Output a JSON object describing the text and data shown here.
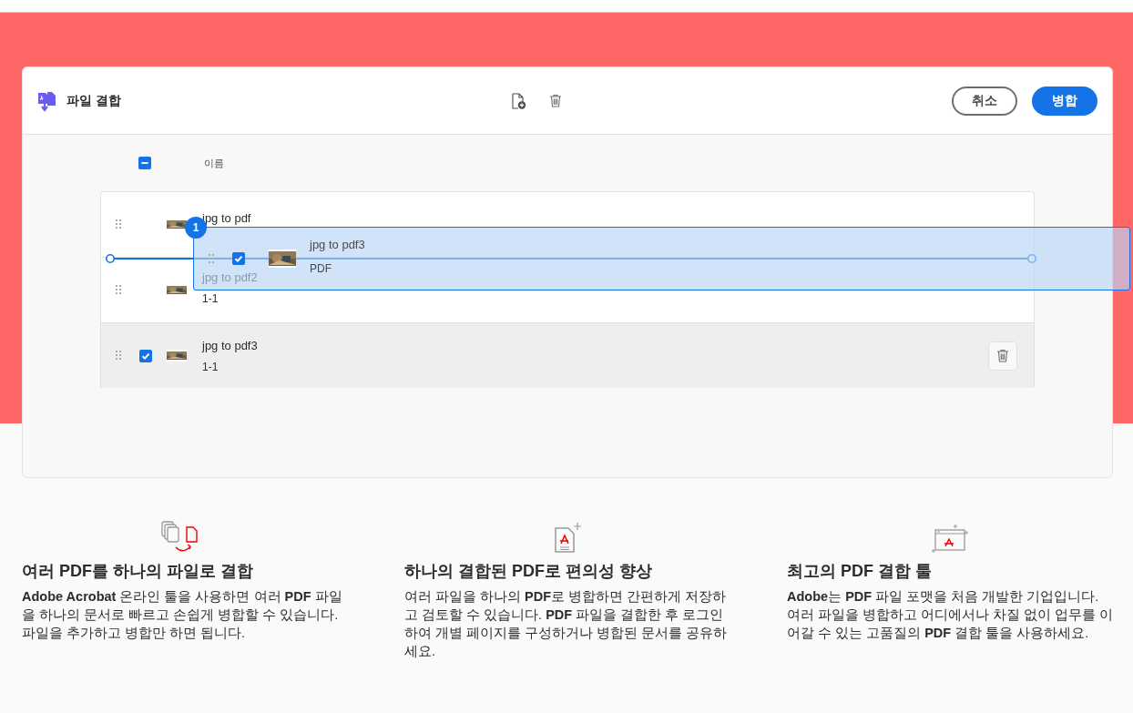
{
  "header": {
    "title": "파일 결합",
    "tools": [
      {
        "kind": "add-file"
      },
      {
        "kind": "delete"
      }
    ],
    "buttons": [
      {
        "label": "취소",
        "kind": "secondary"
      },
      {
        "label": "병합",
        "kind": "primary"
      }
    ]
  },
  "list": {
    "header_checked": true,
    "header_indeterminate": true,
    "column_heading": "이름",
    "files": [
      {
        "name": "jpg to pdf",
        "checked": false,
        "selected": false
      },
      {
        "name": "jpg to pdf2",
        "pages": "1-1",
        "checked": false,
        "selected": false
      },
      {
        "name": "jpg to pdf3",
        "pages": "1-1",
        "checked": true,
        "selected": true
      }
    ],
    "drag_preview": {
      "count": "1",
      "name": "jpg to pdf3",
      "type": "PDF",
      "checked": true
    }
  },
  "features": [
    {
      "kind": "pages",
      "title": "여러 PDF를 하나의 파일로 결합",
      "text": "**Adobe Acrobat** 온라인 툴을 사용하면 여러 **PDF** 파일을 하나의 문서로 빠르고 손쉽게 병합할 수 있습니다. 파일을 추가하고 병합만 하면 됩니다."
    },
    {
      "kind": "pdf-add",
      "title": "하나의 결합된 PDF로 편의성 향상",
      "text": "여러 파일을 하나의 **PDF**로 병합하면 간편하게 저장하고 검토할 수 있습니다. **PDF** 파일을 결합한 후 로그인하여 개별 페이지를 구성하거나 병합된 문서를 공유하세요."
    },
    {
      "kind": "browser-pdf",
      "title": "최고의 PDF 결합 툴",
      "text": "**Adobe**는 **PDF** 파일 포맷을 처음 개발한 기업입니다. 여러 파일을 병합하고 어디에서나 차질 없이 업무를 이어갈 수 있는 고품질의 **PDF** 결합 툴을 사용하세요."
    }
  ]
}
